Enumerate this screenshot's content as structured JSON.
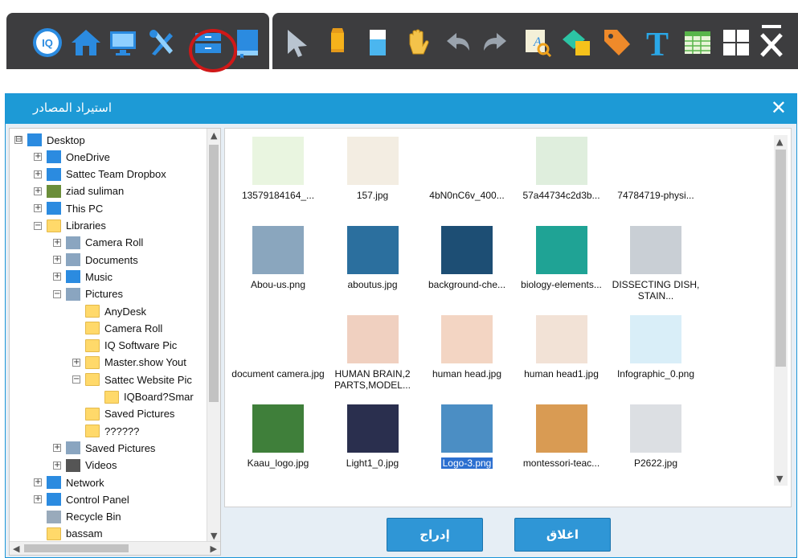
{
  "toolbar": {
    "left_icons": [
      "iq-logo-icon",
      "home-icon",
      "monitor-icon",
      "tools-icon",
      "resources-icon",
      "book-icon"
    ],
    "right_icons": [
      "cursor-icon",
      "pencil-icon",
      "eraser-icon",
      "hand-icon",
      "undo-icon",
      "redo-icon",
      "text-recognition-icon",
      "shapes-icon",
      "tag-icon",
      "text-icon",
      "table-icon",
      "grid-icon",
      "minimize-close-icon"
    ],
    "highlight_color": "#d01818"
  },
  "dialog": {
    "title": "استيراد المصادر",
    "close_label": "✕",
    "insert_label": "إدراج",
    "close_button_label": "اغلاق",
    "accent_color": "#1d9ad6"
  },
  "tree": [
    {
      "label": "Desktop",
      "expander": "⊟",
      "icon": "desktop"
    },
    {
      "label": "OneDrive",
      "expander": "+",
      "icon": "cloud"
    },
    {
      "label": "Sattec Team Dropbox",
      "expander": "+",
      "icon": "dropbox"
    },
    {
      "label": "ziad suliman",
      "expander": "+",
      "icon": "user"
    },
    {
      "label": "This PC",
      "expander": "+",
      "icon": "monitor"
    },
    {
      "label": "Libraries",
      "expander": "−",
      "icon": "library"
    },
    {
      "label": "Camera Roll",
      "expander": "+",
      "icon": "library-item"
    },
    {
      "label": "Documents",
      "expander": "+",
      "icon": "document"
    },
    {
      "label": "Music",
      "expander": "+",
      "icon": "music"
    },
    {
      "label": "Pictures",
      "expander": "−",
      "icon": "library-item"
    },
    {
      "label": "AnyDesk",
      "expander": "",
      "icon": "folder"
    },
    {
      "label": "Camera Roll",
      "expander": "",
      "icon": "folder"
    },
    {
      "label": "IQ Software Pic",
      "expander": "",
      "icon": "folder"
    },
    {
      "label": "Master.show Yout",
      "expander": "+",
      "icon": "folder"
    },
    {
      "label": "Sattec Website Pic",
      "expander": "−",
      "icon": "folder"
    },
    {
      "label": "IQBoard?Smar",
      "expander": "",
      "icon": "folder"
    },
    {
      "label": "Saved Pictures",
      "expander": "",
      "icon": "folder"
    },
    {
      "label": "??????",
      "expander": "",
      "icon": "folder"
    },
    {
      "label": "Saved Pictures",
      "expander": "+",
      "icon": "library-item"
    },
    {
      "label": "Videos",
      "expander": "+",
      "icon": "video"
    },
    {
      "label": "Network",
      "expander": "+",
      "icon": "network"
    },
    {
      "label": "Control Panel",
      "expander": "+",
      "icon": "control-panel"
    },
    {
      "label": "Recycle Bin",
      "expander": "",
      "icon": "recycle"
    },
    {
      "label": "bassam",
      "expander": "",
      "icon": "folder"
    }
  ],
  "files": [
    {
      "name": "13579184164_...",
      "thumb": "circle-diagram"
    },
    {
      "name": "157.jpg",
      "thumb": "classroom"
    },
    {
      "name": "4bN0nC6v_400...",
      "thumb": "arabic-logo"
    },
    {
      "name": "57a44734c2d3b...",
      "thumb": "math-symbols"
    },
    {
      "name": "74784719-physi...",
      "thumb": "atom"
    },
    {
      "name": "Abou-us.png",
      "thumb": "business"
    },
    {
      "name": "aboutus.jpg",
      "thumb": "about-us"
    },
    {
      "name": "background-che...",
      "thumb": "chemistry"
    },
    {
      "name": "biology-elements...",
      "thumb": "biology"
    },
    {
      "name": "DISSECTING DISH, STAIN...",
      "thumb": "dish"
    },
    {
      "name": "document camera.jpg",
      "thumb": "doc-camera"
    },
    {
      "name": "HUMAN BRAIN,2 PARTS,MODEL...",
      "thumb": "brain"
    },
    {
      "name": "human head.jpg",
      "thumb": "head"
    },
    {
      "name": "human head1.jpg",
      "thumb": "head-model"
    },
    {
      "name": "Infographic_0.png",
      "thumb": "infographic"
    },
    {
      "name": "Kaau_logo.jpg",
      "thumb": "kaau-logo"
    },
    {
      "name": "Light1_0.jpg",
      "thumb": "light"
    },
    {
      "name": "Logo-3.png",
      "thumb": "logo3",
      "selected": true
    },
    {
      "name": "montessori-teac...",
      "thumb": "montessori"
    },
    {
      "name": "P2622.jpg",
      "thumb": "lab-equipment"
    }
  ]
}
